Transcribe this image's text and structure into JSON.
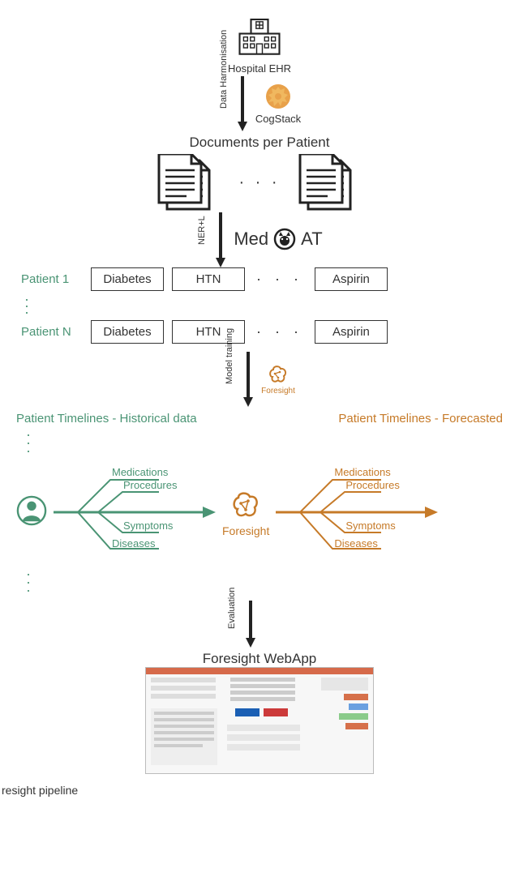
{
  "hospital": {
    "label": "Hospital EHR"
  },
  "arrows": {
    "harmonisation": "Data Harmonisation",
    "nerl": "NER+L",
    "training": "Model training",
    "evaluation": "Evaluation"
  },
  "cogstack": {
    "label": "CogStack"
  },
  "docs_title": "Documents per Patient",
  "medcat": {
    "prefix": "Med",
    "suffix": "AT"
  },
  "patients": {
    "p1_label": "Patient 1",
    "pn_label": "Patient N",
    "chip1": "Diabetes",
    "chip2": "HTN",
    "chip3": "Aspirin"
  },
  "foresight": {
    "label": "Foresight"
  },
  "timelines": {
    "historical_title": "Patient Timelines - Historical data",
    "forecasted_title": "Patient Timelines - Forecasted",
    "medications": "Medications",
    "procedures": "Procedures",
    "symptoms": "Symptoms",
    "diseases": "Diseases"
  },
  "webapp": {
    "title": "Foresight WebApp"
  },
  "caption": "resight pipeline"
}
